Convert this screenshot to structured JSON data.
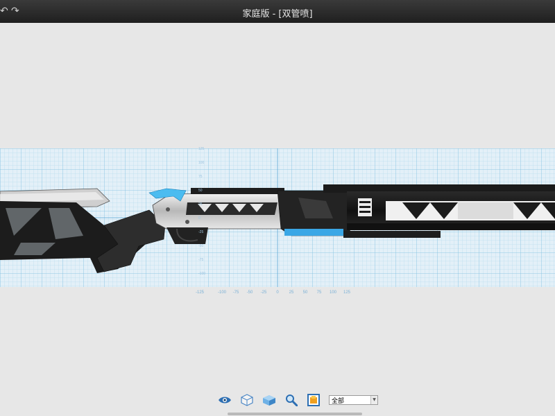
{
  "window": {
    "title": "家庭版 - [双管喷]",
    "undo_icon": "undo-icon",
    "redo_icon": "redo-icon"
  },
  "grid": {
    "x_tick_labels": [
      "-125",
      "-100",
      "-75",
      "-50",
      "-25",
      "0",
      "25",
      "50",
      "75",
      "100",
      "125"
    ],
    "y_tick_labels": [
      "125",
      "100",
      "75",
      "50",
      "25",
      "0",
      "-25",
      "-50",
      "-75",
      "-100"
    ],
    "colors": {
      "grid": "#9ccde6",
      "grid_major": "#6fb3da",
      "background": "#e2eff7"
    }
  },
  "toolbar": {
    "tools": [
      {
        "name": "visibility",
        "icon": "eye-icon"
      },
      {
        "name": "view-cube",
        "icon": "cube-outline-icon"
      },
      {
        "name": "solid-view",
        "icon": "cube-solid-icon"
      },
      {
        "name": "zoom",
        "icon": "magnifier-icon"
      },
      {
        "name": "materials",
        "icon": "material-swatch-icon"
      }
    ],
    "layer_select": {
      "value": "全部"
    }
  },
  "colors": {
    "titlebar": "#2b2b2b",
    "accent": "#3aa7e6",
    "body": "#1b1b1b"
  }
}
